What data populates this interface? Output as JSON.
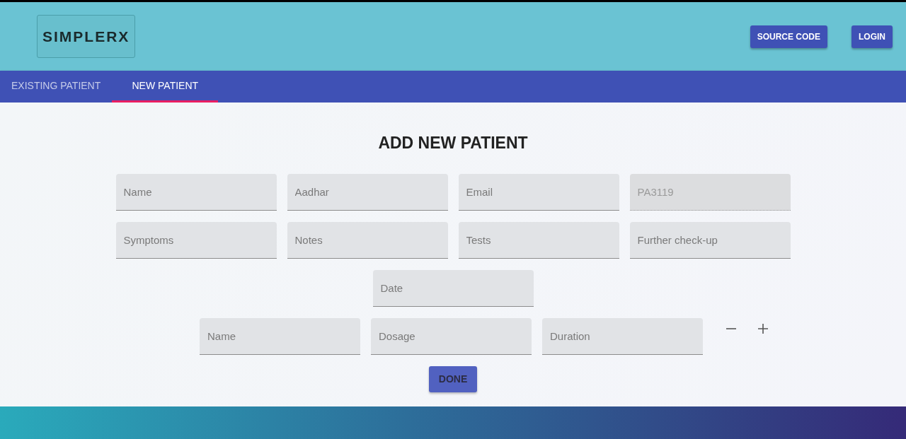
{
  "header": {
    "logo": "SIMPLERX",
    "buttons": [
      "SOURCE CODE",
      "LOGIN"
    ]
  },
  "tabs": [
    {
      "label": "EXISTING PATIENT",
      "selected": false
    },
    {
      "label": "NEW PATIENT",
      "selected": true
    }
  ],
  "form": {
    "title": "ADD NEW PATIENT",
    "patient_fields": [
      {
        "placeholder": "Name",
        "disabled": false
      },
      {
        "placeholder": "Aadhar",
        "disabled": false
      },
      {
        "placeholder": "Email",
        "disabled": false
      },
      {
        "value": "PA3119",
        "disabled": true
      }
    ],
    "visit_fields": [
      {
        "placeholder": "Symptoms"
      },
      {
        "placeholder": "Notes"
      },
      {
        "placeholder": "Tests"
      },
      {
        "placeholder": "Further check-up"
      }
    ],
    "date_field": {
      "placeholder": "Date"
    },
    "medicine_fields": [
      {
        "placeholder": "Name"
      },
      {
        "placeholder": "Dosage"
      },
      {
        "placeholder": "Duration"
      }
    ],
    "submit": "DONE"
  }
}
